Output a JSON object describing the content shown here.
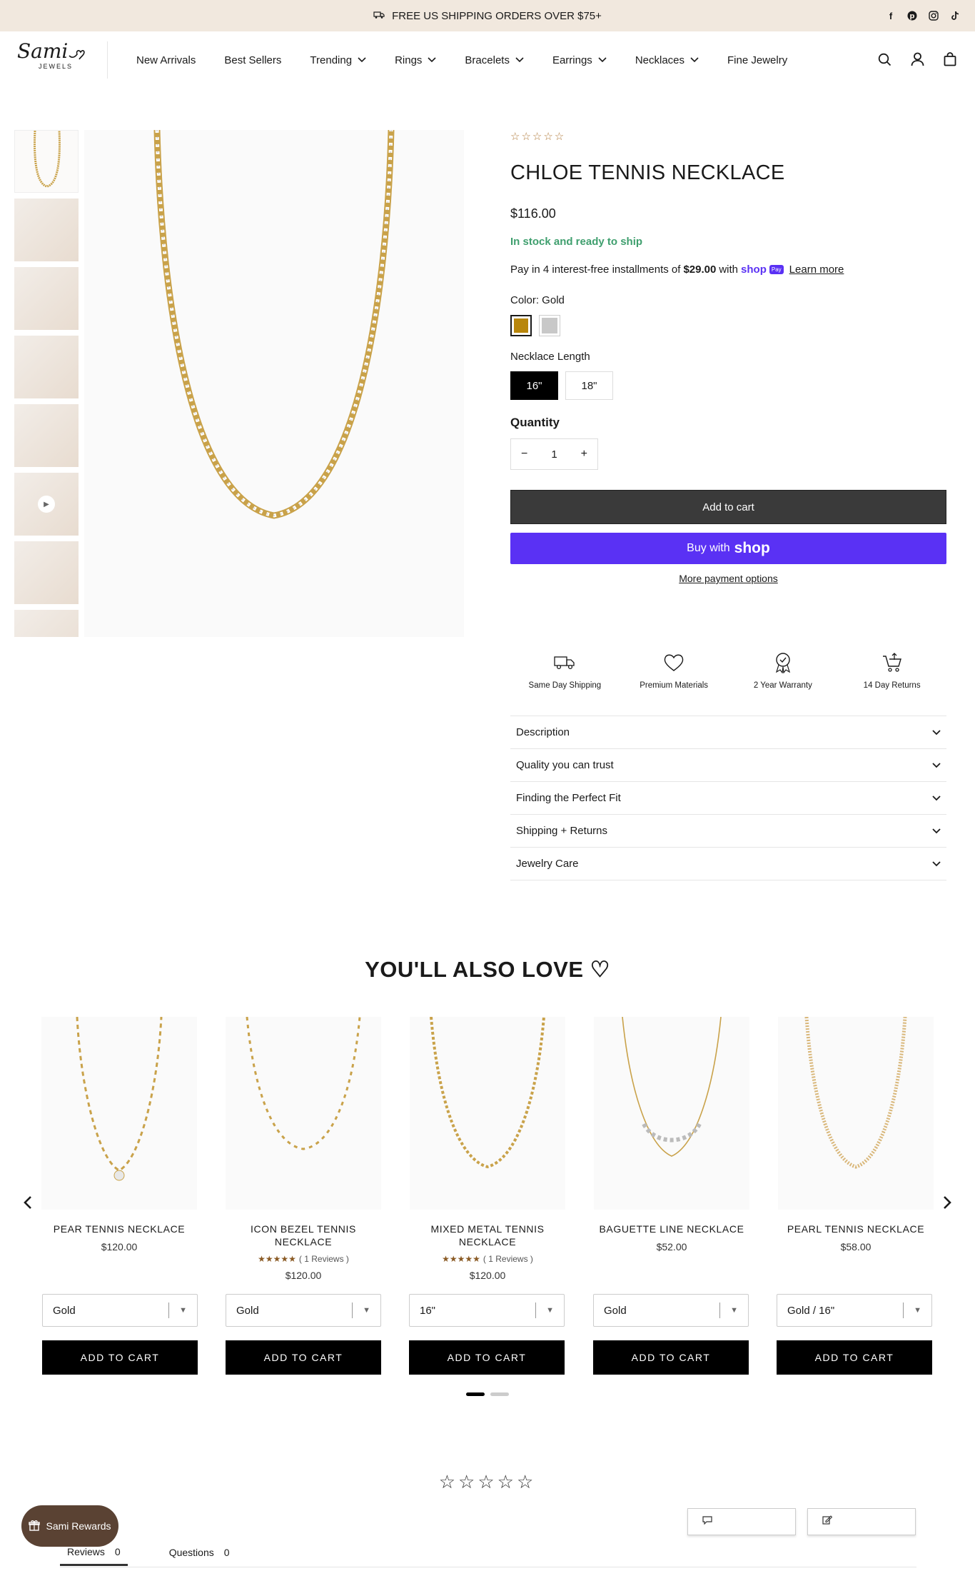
{
  "announcement": {
    "text": "FREE US SHIPPING ORDERS OVER $75+",
    "icon": "truck-icon"
  },
  "social": [
    "facebook-icon",
    "pinterest-icon",
    "instagram-icon",
    "tiktok-icon"
  ],
  "logo": {
    "script": "Sami",
    "sub": "JEWELS"
  },
  "nav": [
    {
      "label": "New Arrivals",
      "dropdown": false
    },
    {
      "label": "Best Sellers",
      "dropdown": false
    },
    {
      "label": "Trending",
      "dropdown": true
    },
    {
      "label": "Rings",
      "dropdown": true
    },
    {
      "label": "Bracelets",
      "dropdown": true
    },
    {
      "label": "Earrings",
      "dropdown": true
    },
    {
      "label": "Necklaces",
      "dropdown": true
    },
    {
      "label": "Fine Jewelry",
      "dropdown": false
    }
  ],
  "product": {
    "stars": "☆☆☆☆☆",
    "title": "CHLOE TENNIS NECKLACE",
    "price": "$116.00",
    "stock": "In stock and ready to ship",
    "installments_prefix": "Pay in 4 interest-free installments of",
    "installments_amount": "$29.00",
    "installments_with": "with",
    "shop_word": "shop",
    "pay_badge": "Pay",
    "learn_more": "Learn more",
    "color_label": "Color: Gold",
    "colors": [
      {
        "name": "Gold",
        "hex": "#b8860b"
      },
      {
        "name": "Silver",
        "hex": "#c8c8c8"
      }
    ],
    "length_label": "Necklace Length",
    "lengths": [
      "16\"",
      "18\""
    ],
    "quantity_label": "Quantity",
    "quantity": "1",
    "minus": "−",
    "plus": "+",
    "add_to_cart": "Add to cart",
    "buy_with": "Buy with",
    "buy_shop": "shop",
    "more_payment": "More payment options"
  },
  "features": [
    {
      "label": "Same Day Shipping",
      "icon": "shipping-truck-icon"
    },
    {
      "label": "Premium Materials",
      "icon": "heart-icon"
    },
    {
      "label": "2 Year Warranty",
      "icon": "award-badge-icon"
    },
    {
      "label": "14 Day Returns",
      "icon": "return-cart-icon"
    }
  ],
  "accordion": [
    "Description",
    "Quality you can trust",
    "Finding the Perfect Fit",
    "Shipping + Returns",
    "Jewelry Care"
  ],
  "related": {
    "title": "YOU'LL ALSO LOVE ♡",
    "products": [
      {
        "name": "PEAR TENNIS NECKLACE",
        "price": "$120.00",
        "stars": "",
        "reviews": "",
        "option": "Gold",
        "cta": "ADD TO CART"
      },
      {
        "name": "ICON BEZEL TENNIS NECKLACE",
        "price": "$120.00",
        "stars": "★★★★★",
        "reviews": "( 1 Reviews )",
        "option": "Gold",
        "cta": "ADD TO CART"
      },
      {
        "name": "MIXED METAL TENNIS NECKLACE",
        "price": "$120.00",
        "stars": "★★★★★",
        "reviews": "( 1 Reviews )",
        "option": "16\"",
        "cta": "ADD TO CART"
      },
      {
        "name": "BAGUETTE LINE NECKLACE",
        "price": "$52.00",
        "stars": "",
        "reviews": "",
        "option": "Gold",
        "cta": "ADD TO CART"
      },
      {
        "name": "PEARL TENNIS NECKLACE",
        "price": "$58.00",
        "stars": "",
        "reviews": "",
        "option": "Gold / 16\"",
        "cta": "ADD TO CART"
      }
    ]
  },
  "reviews": {
    "stars": "☆☆☆☆☆",
    "tabs": [
      {
        "label": "Reviews",
        "count": "0"
      },
      {
        "label": "Questions",
        "count": "0"
      }
    ]
  },
  "rewards": {
    "label": "Sami Rewards"
  }
}
